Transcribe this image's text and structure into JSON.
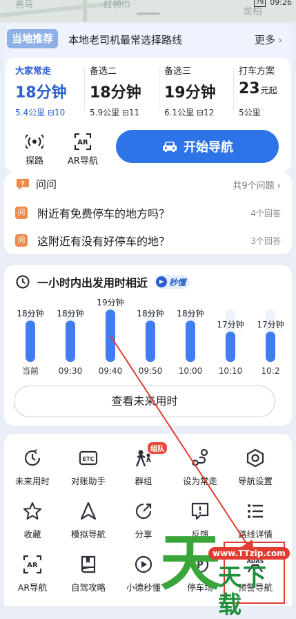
{
  "map": {
    "place_left": "亮马",
    "place_mid": "红领巾",
    "place_right": "龙柏",
    "clock": "09:26",
    "battery": "79"
  },
  "recommend": {
    "tag": "当地推荐",
    "subtitle": "本地老司机最常选择路线",
    "more": "更多",
    "routes": [
      {
        "label": "大家常走",
        "time": "18分钟",
        "meta": "5.4公里 ⊟10",
        "active": true
      },
      {
        "label": "备选二",
        "time": "18分钟",
        "meta": "5.9公里 ⊟11",
        "active": false
      },
      {
        "label": "备选三",
        "time": "19分钟",
        "meta": "6.1公里 ⊟12",
        "active": false
      },
      {
        "label": "打车方案",
        "time": "23",
        "time_unit": "元起",
        "meta": "5公里",
        "active": false
      }
    ],
    "probe": "探路",
    "ar_nav": "AR导航",
    "start_nav": "开始导航"
  },
  "qa": {
    "title": "问问",
    "count": "共9个问题",
    "badge": "问",
    "items": [
      {
        "q": "附近有免费停车的地方吗？",
        "a": "4个回答"
      },
      {
        "q": "这附近有没有好停车的地？",
        "a": "3个回答"
      }
    ]
  },
  "timing": {
    "title": "一小时内出发用时相近",
    "badge": "秒懂",
    "view_button": "查看未来用时"
  },
  "chart_data": {
    "type": "bar",
    "categories": [
      "当前",
      "09:30",
      "09:40",
      "09:50",
      "10:00",
      "10:10",
      "10:2"
    ],
    "values": [
      18,
      18,
      19,
      18,
      18,
      17,
      17
    ],
    "data_labels": [
      "18分钟",
      "18分钟",
      "19分钟",
      "18分钟",
      "18分钟",
      "17分钟",
      "17分钟"
    ],
    "highlight_index": 2,
    "colors": {
      "bar": "#3f7ef0",
      "track": "#eef2fa"
    }
  },
  "tools": [
    {
      "label": "未来用时",
      "icon": "clock-icon"
    },
    {
      "label": "对账助手",
      "icon": "etc-icon"
    },
    {
      "label": "群组",
      "icon": "group-icon",
      "badge": "组队"
    },
    {
      "label": "设为常走",
      "icon": "route-pin-icon"
    },
    {
      "label": "导航设置",
      "icon": "gear-hex-icon"
    },
    {
      "label": "收藏",
      "icon": "star-icon"
    },
    {
      "label": "模拟导航",
      "icon": "navigation-arrow-icon"
    },
    {
      "label": "分享",
      "icon": "share-icon"
    },
    {
      "label": "反馈",
      "icon": "feedback-icon"
    },
    {
      "label": "路线详情",
      "icon": "list-icon"
    },
    {
      "label": "AR导航",
      "icon": "ar-icon"
    },
    {
      "label": "自驾攻略",
      "icon": "book-icon"
    },
    {
      "label": "小德秒懂",
      "icon": "play-circle-icon"
    },
    {
      "label": "停车场",
      "icon": "parking-icon"
    },
    {
      "label": "预警导航",
      "icon": "adas-icon"
    }
  ],
  "watermark": {
    "url": "www.TTzip.com",
    "big": "天",
    "text": "天下载"
  },
  "colors": {
    "accent": "#2d74e8",
    "active_text": "#2b5fd1",
    "annotation": "#e23b2f"
  }
}
